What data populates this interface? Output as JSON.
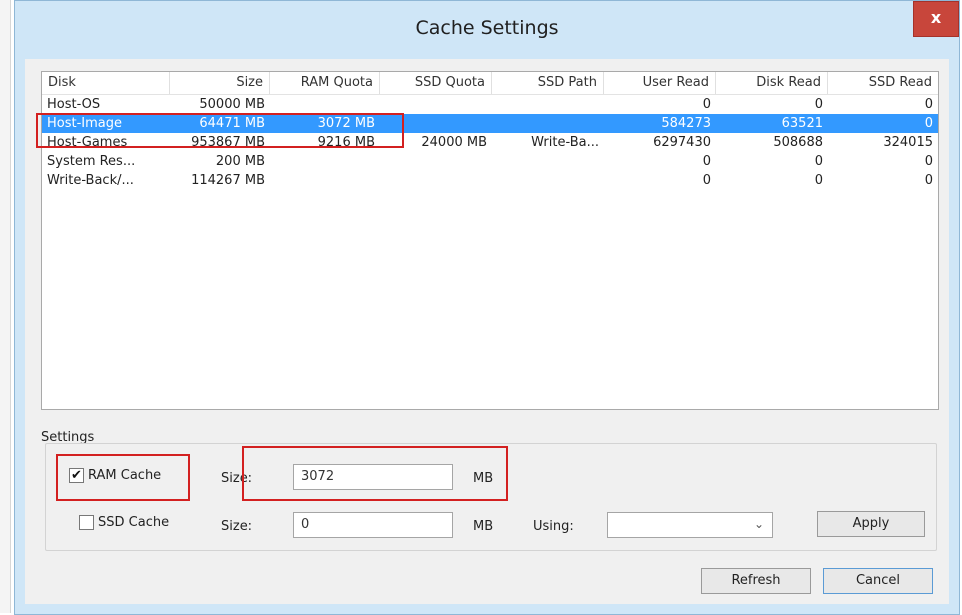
{
  "window": {
    "title": "Cache Settings",
    "close_glyph": "x"
  },
  "list": {
    "columns": [
      "Disk",
      "Size",
      "RAM Quota",
      "SSD Quota",
      "SSD Path",
      "User Read",
      "Disk Read",
      "SSD Read"
    ],
    "rows": [
      [
        "Host-OS",
        "50000 MB",
        "",
        "",
        "",
        "0",
        "0",
        "0"
      ],
      [
        "Host-Image",
        "64471 MB",
        "3072 MB",
        "",
        "",
        "584273",
        "63521",
        "0"
      ],
      [
        "Host-Games",
        "953867 MB",
        "9216 MB",
        "24000 MB",
        "Write-Ba...",
        "6297430",
        "508688",
        "324015"
      ],
      [
        "System Res...",
        "200 MB",
        "",
        "",
        "",
        "0",
        "0",
        "0"
      ],
      [
        "Write-Back/...",
        "114267 MB",
        "",
        "",
        "",
        "0",
        "0",
        "0"
      ]
    ],
    "selected_index": 1
  },
  "settings": {
    "group_label": "Settings",
    "ram_cache": {
      "label": "RAM Cache",
      "checked": true,
      "check_glyph": "✔"
    },
    "ssd_cache": {
      "label": "SSD Cache",
      "checked": false
    },
    "size_label": "Size:",
    "ram_size_value": "3072",
    "ssd_size_value": "0",
    "unit": "MB",
    "using_label": "Using:",
    "using_value": "",
    "combo_arrow": "⌄",
    "apply_label": "Apply"
  },
  "buttons": {
    "refresh": "Refresh",
    "cancel": "Cancel"
  },
  "colors": {
    "selection": "#3399ff",
    "highlight": "#d32020",
    "close_button": "#c8463b"
  }
}
